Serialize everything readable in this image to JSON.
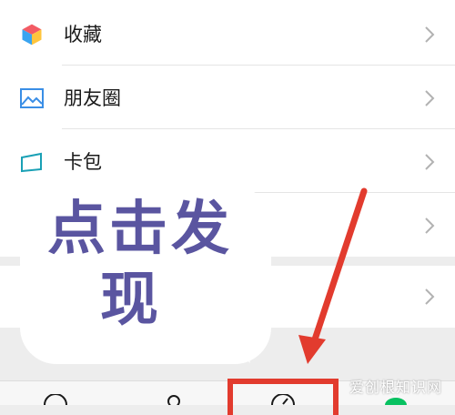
{
  "menu": {
    "items": [
      {
        "label": "收藏",
        "icon": "favorites-cube-icon"
      },
      {
        "label": "朋友圈",
        "icon": "moments-image-icon"
      },
      {
        "label": "卡包",
        "icon": "card-wallet-icon"
      }
    ]
  },
  "annotation": {
    "line1": "点击发",
    "line2": "现"
  },
  "watermark": "爱创根知识网",
  "colors": {
    "annotation_text": "#5a55a0",
    "highlight_red": "#e23b2e",
    "wechat_green": "#07c160"
  }
}
